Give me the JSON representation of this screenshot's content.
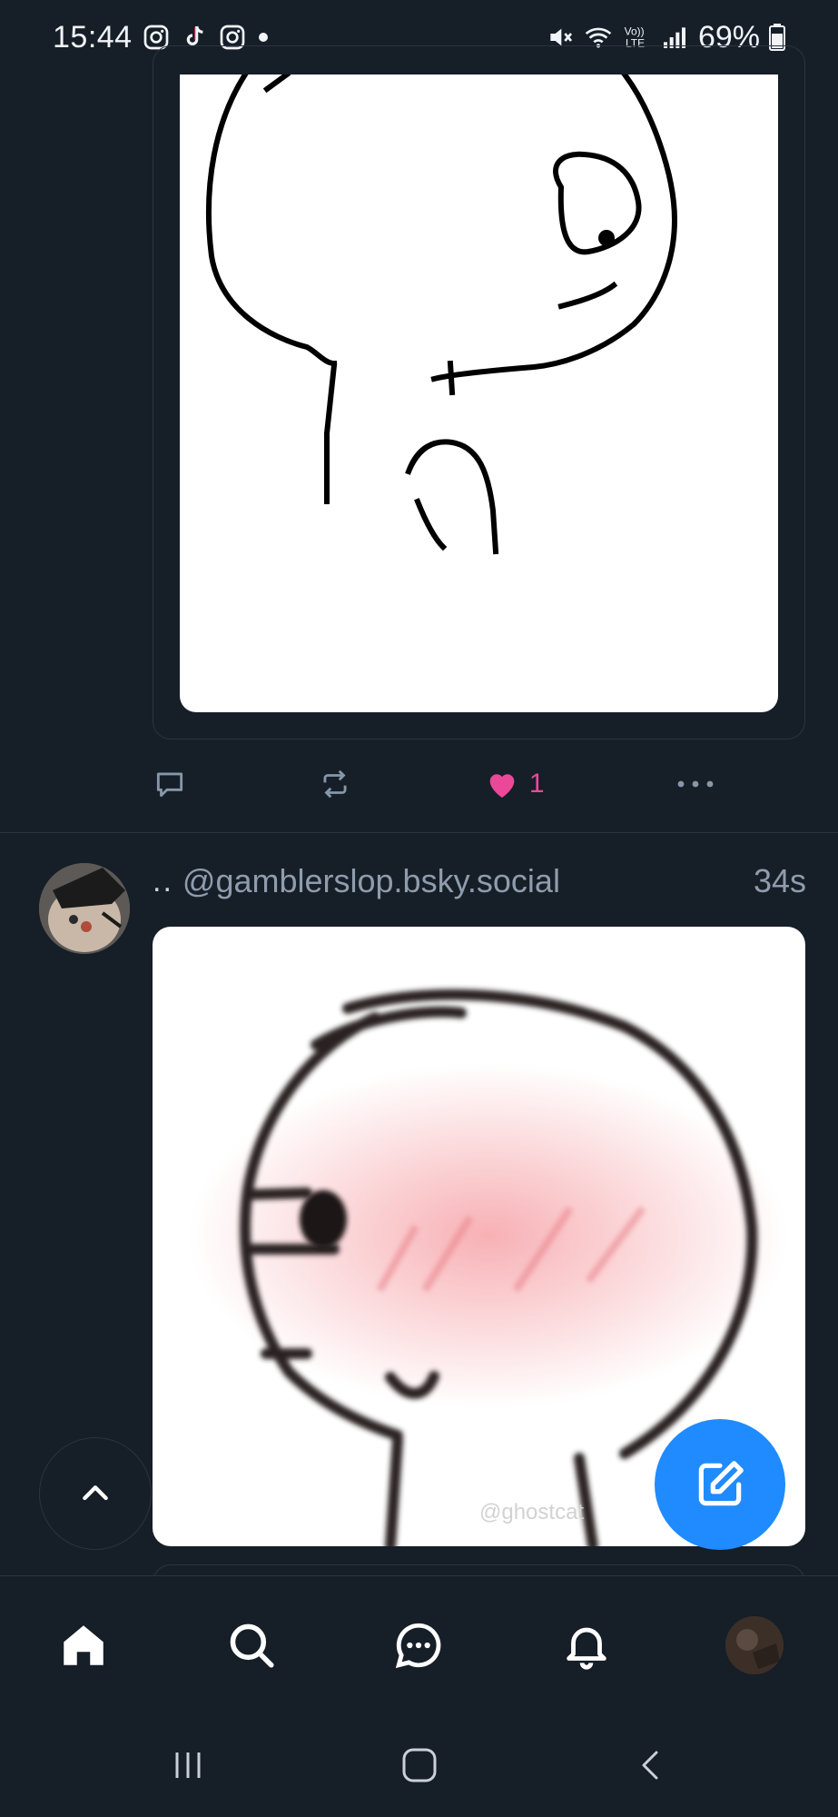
{
  "status_bar": {
    "time": "15:44",
    "notification_icons": [
      "instagram-icon",
      "tiktok-icon",
      "instagram-icon",
      "dot-icon"
    ],
    "system_icons": [
      "mute-icon",
      "wifi-icon",
      "volte-icon",
      "signal-icon"
    ],
    "battery_percent": "69%"
  },
  "previous_post": {
    "actions": {
      "reply_icon": "reply-icon",
      "repost_icon": "repost-icon",
      "like_icon": "heart-icon",
      "like_count": "1",
      "more_icon": "more-icon"
    }
  },
  "post": {
    "author_prefix": "..",
    "handle": "@gamblerslop.bsky.social",
    "time": "34s",
    "image_watermark": "@ghostcat"
  },
  "fab": {
    "scroll_top_icon": "chevron-up-icon",
    "compose_icon": "compose-icon"
  },
  "bottom_nav": {
    "items": [
      "home-icon",
      "search-icon",
      "chat-icon",
      "bell-icon",
      "profile-avatar"
    ]
  },
  "colors": {
    "background": "#161e27",
    "accent": "#208bfe",
    "like": "#ec4899",
    "muted": "#8797aa",
    "border": "#2a3542"
  }
}
